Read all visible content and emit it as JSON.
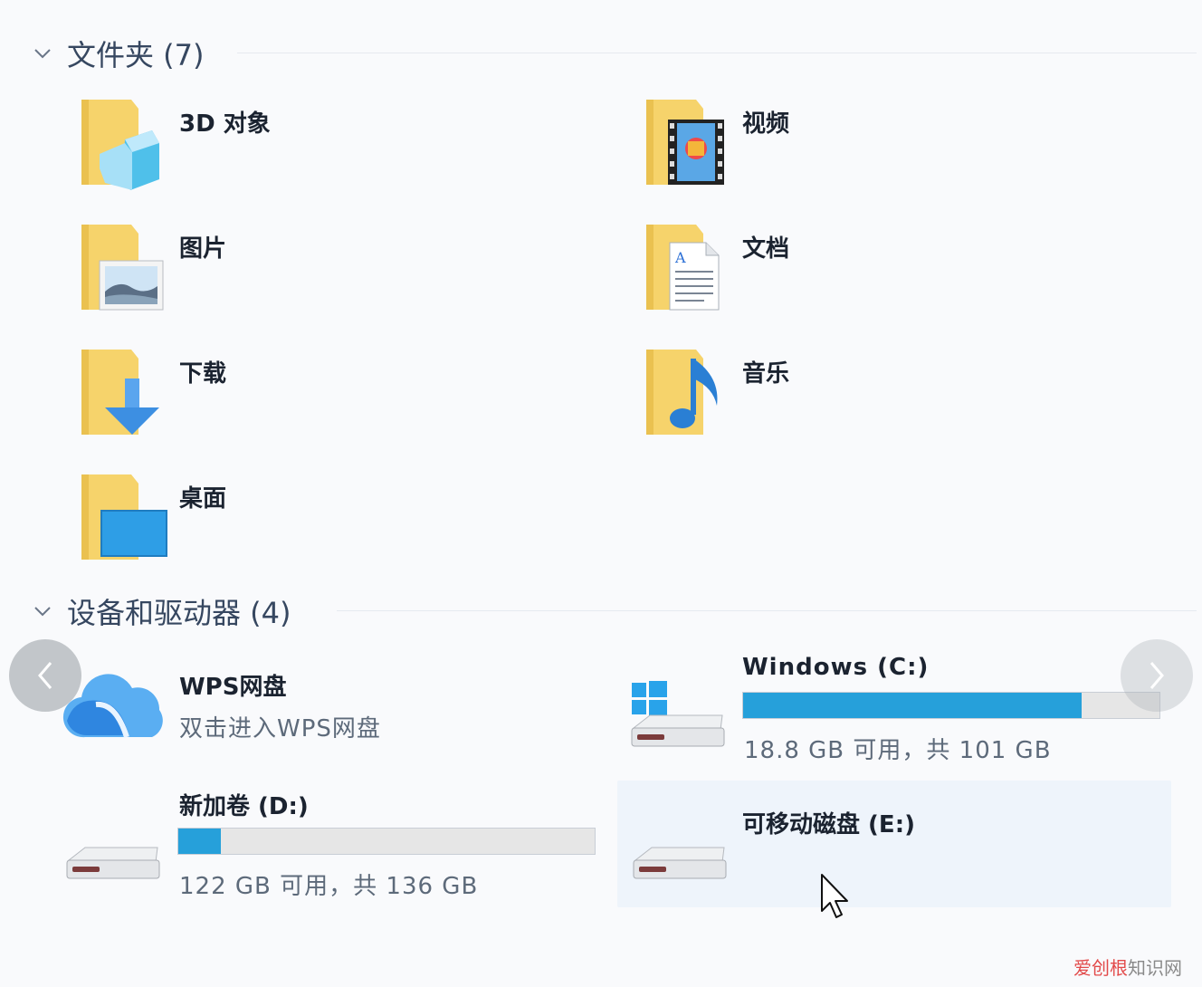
{
  "sections": {
    "folders": {
      "title": "文件夹 (7)"
    },
    "drives": {
      "title": "设备和驱动器 (4)"
    }
  },
  "folders": [
    {
      "label": "3D 对象"
    },
    {
      "label": "视频"
    },
    {
      "label": "图片"
    },
    {
      "label": "文档"
    },
    {
      "label": "下载"
    },
    {
      "label": "音乐"
    },
    {
      "label": "桌面"
    }
  ],
  "drives": {
    "wps": {
      "label": "WPS网盘",
      "sub": "双击进入WPS网盘"
    },
    "c": {
      "label": "Windows  (C:)",
      "usage": "18.8 GB 可用，共 101 GB",
      "used_fraction": 0.814
    },
    "d": {
      "label": "新加卷 (D:)",
      "usage": "122 GB 可用，共 136 GB",
      "used_fraction": 0.103
    },
    "e": {
      "label": "可移动磁盘 (E:)"
    }
  },
  "colors": {
    "bar_fill": "#26a0da",
    "bar_bg": "#e6e6e6",
    "folder": "#f6d36b"
  },
  "icons": {
    "nav_prev": "chevron-left-icon",
    "nav_next": "chevron-right-icon",
    "collapse": "chevron-down-icon"
  },
  "watermark": {
    "brand": "爱创根",
    "site": "知识网"
  }
}
